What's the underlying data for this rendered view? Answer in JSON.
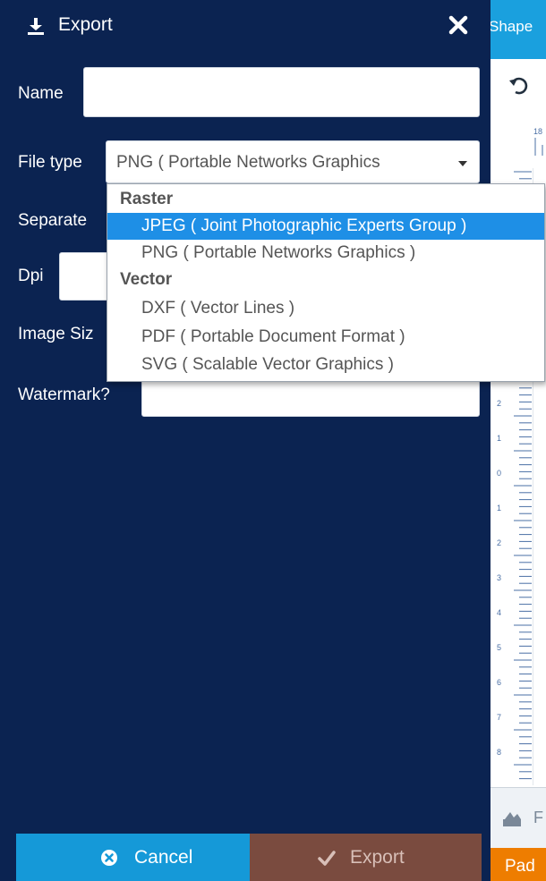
{
  "header": {
    "title": "Export",
    "icon": "download-icon",
    "close_icon": "close-icon"
  },
  "form": {
    "name_label": "Name",
    "name_value": "",
    "file_type_label": "File type",
    "file_type_selected": "PNG ( Portable Networks Graphics",
    "separate_label": "Separate",
    "dpi_label": "Dpi",
    "image_size_label": "Image Siz",
    "watermark_label": "Watermark?",
    "watermark_value": ""
  },
  "dropdown": {
    "groups": [
      {
        "label": "Raster",
        "options": [
          {
            "label": "JPEG ( Joint Photographic Experts Group )",
            "selected": true
          },
          {
            "label": "PNG ( Portable Networks Graphics )",
            "selected": false
          }
        ]
      },
      {
        "label": "Vector",
        "options": [
          {
            "label": "DXF ( Vector Lines )",
            "selected": false
          },
          {
            "label": "PDF ( Portable Document Format )",
            "selected": false
          },
          {
            "label": "SVG ( Scalable Vector Graphics )",
            "selected": false
          }
        ]
      }
    ]
  },
  "buttons": {
    "cancel": "Cancel",
    "export": "Export"
  },
  "right_panel": {
    "shape_tab": "Shape",
    "ruler_top_label": "18",
    "ruler_left_numbers": [
      "2",
      "1",
      "0",
      "1",
      "2",
      "3",
      "4",
      "5",
      "6",
      "7",
      "8"
    ],
    "fit_text": "F",
    "pad_button": "Pad"
  },
  "colors": {
    "panel_bg": "#0b2351",
    "accent_blue": "#1599d8",
    "export_brown": "#7a4b3f",
    "selected_blue": "#1e8fe6",
    "pad_orange": "#ee7d00"
  }
}
